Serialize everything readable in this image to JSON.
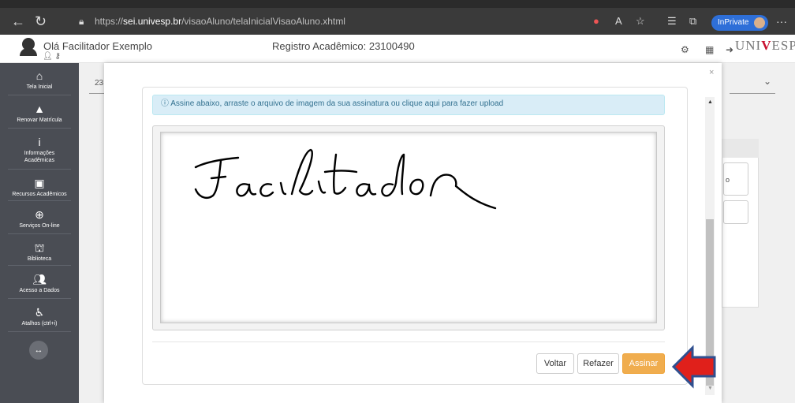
{
  "browser": {
    "url_scheme": "https://",
    "url_host": "sei.univesp.br",
    "url_path": "/visaoAluno/telaInicialVisaoAluno.xhtml",
    "inprivate_label": "InPrivate"
  },
  "header": {
    "greeting": "Olá Facilitador Exemplo",
    "registro": "Registro Acadêmico: 23100490",
    "logo_text_left": "UNI",
    "logo_text_v": "V",
    "logo_text_right": "ESP"
  },
  "sidebar": {
    "items": [
      {
        "label": "Tela Inicial",
        "icon": "home-icon"
      },
      {
        "label": "Renovar Matrícula",
        "icon": "warning-icon"
      },
      {
        "label": "Informações",
        "label2": "Acadêmicas",
        "icon": "info-icon"
      },
      {
        "label": "Recursos Acadêmicos",
        "icon": "book-icon"
      },
      {
        "label": "Serviços On-line",
        "icon": "globe-icon"
      },
      {
        "label": "Biblioteca",
        "icon": "library-icon"
      },
      {
        "label": "Acesso a Dados",
        "icon": "users-icon"
      },
      {
        "label": "Atalhos (ctrl+i)",
        "icon": "accessibility-icon"
      }
    ]
  },
  "background": {
    "tab_number": "23",
    "field_text": "o"
  },
  "modal": {
    "alert_text": "Assine abaixo, arraste o arquivo de imagem da sua assinatura ou clique aqui para fazer upload",
    "signature_text": "Facilitador",
    "buttons": {
      "voltar": "Voltar",
      "refazer": "Refazer",
      "assinar": "Assinar"
    }
  },
  "colors": {
    "sidebar_bg": "#4a4d54",
    "assinar_btn": "#f0ad4e",
    "alert_bg": "#d9edf7",
    "arrow_red": "#e0201b",
    "arrow_outline": "#2f4f8f"
  }
}
